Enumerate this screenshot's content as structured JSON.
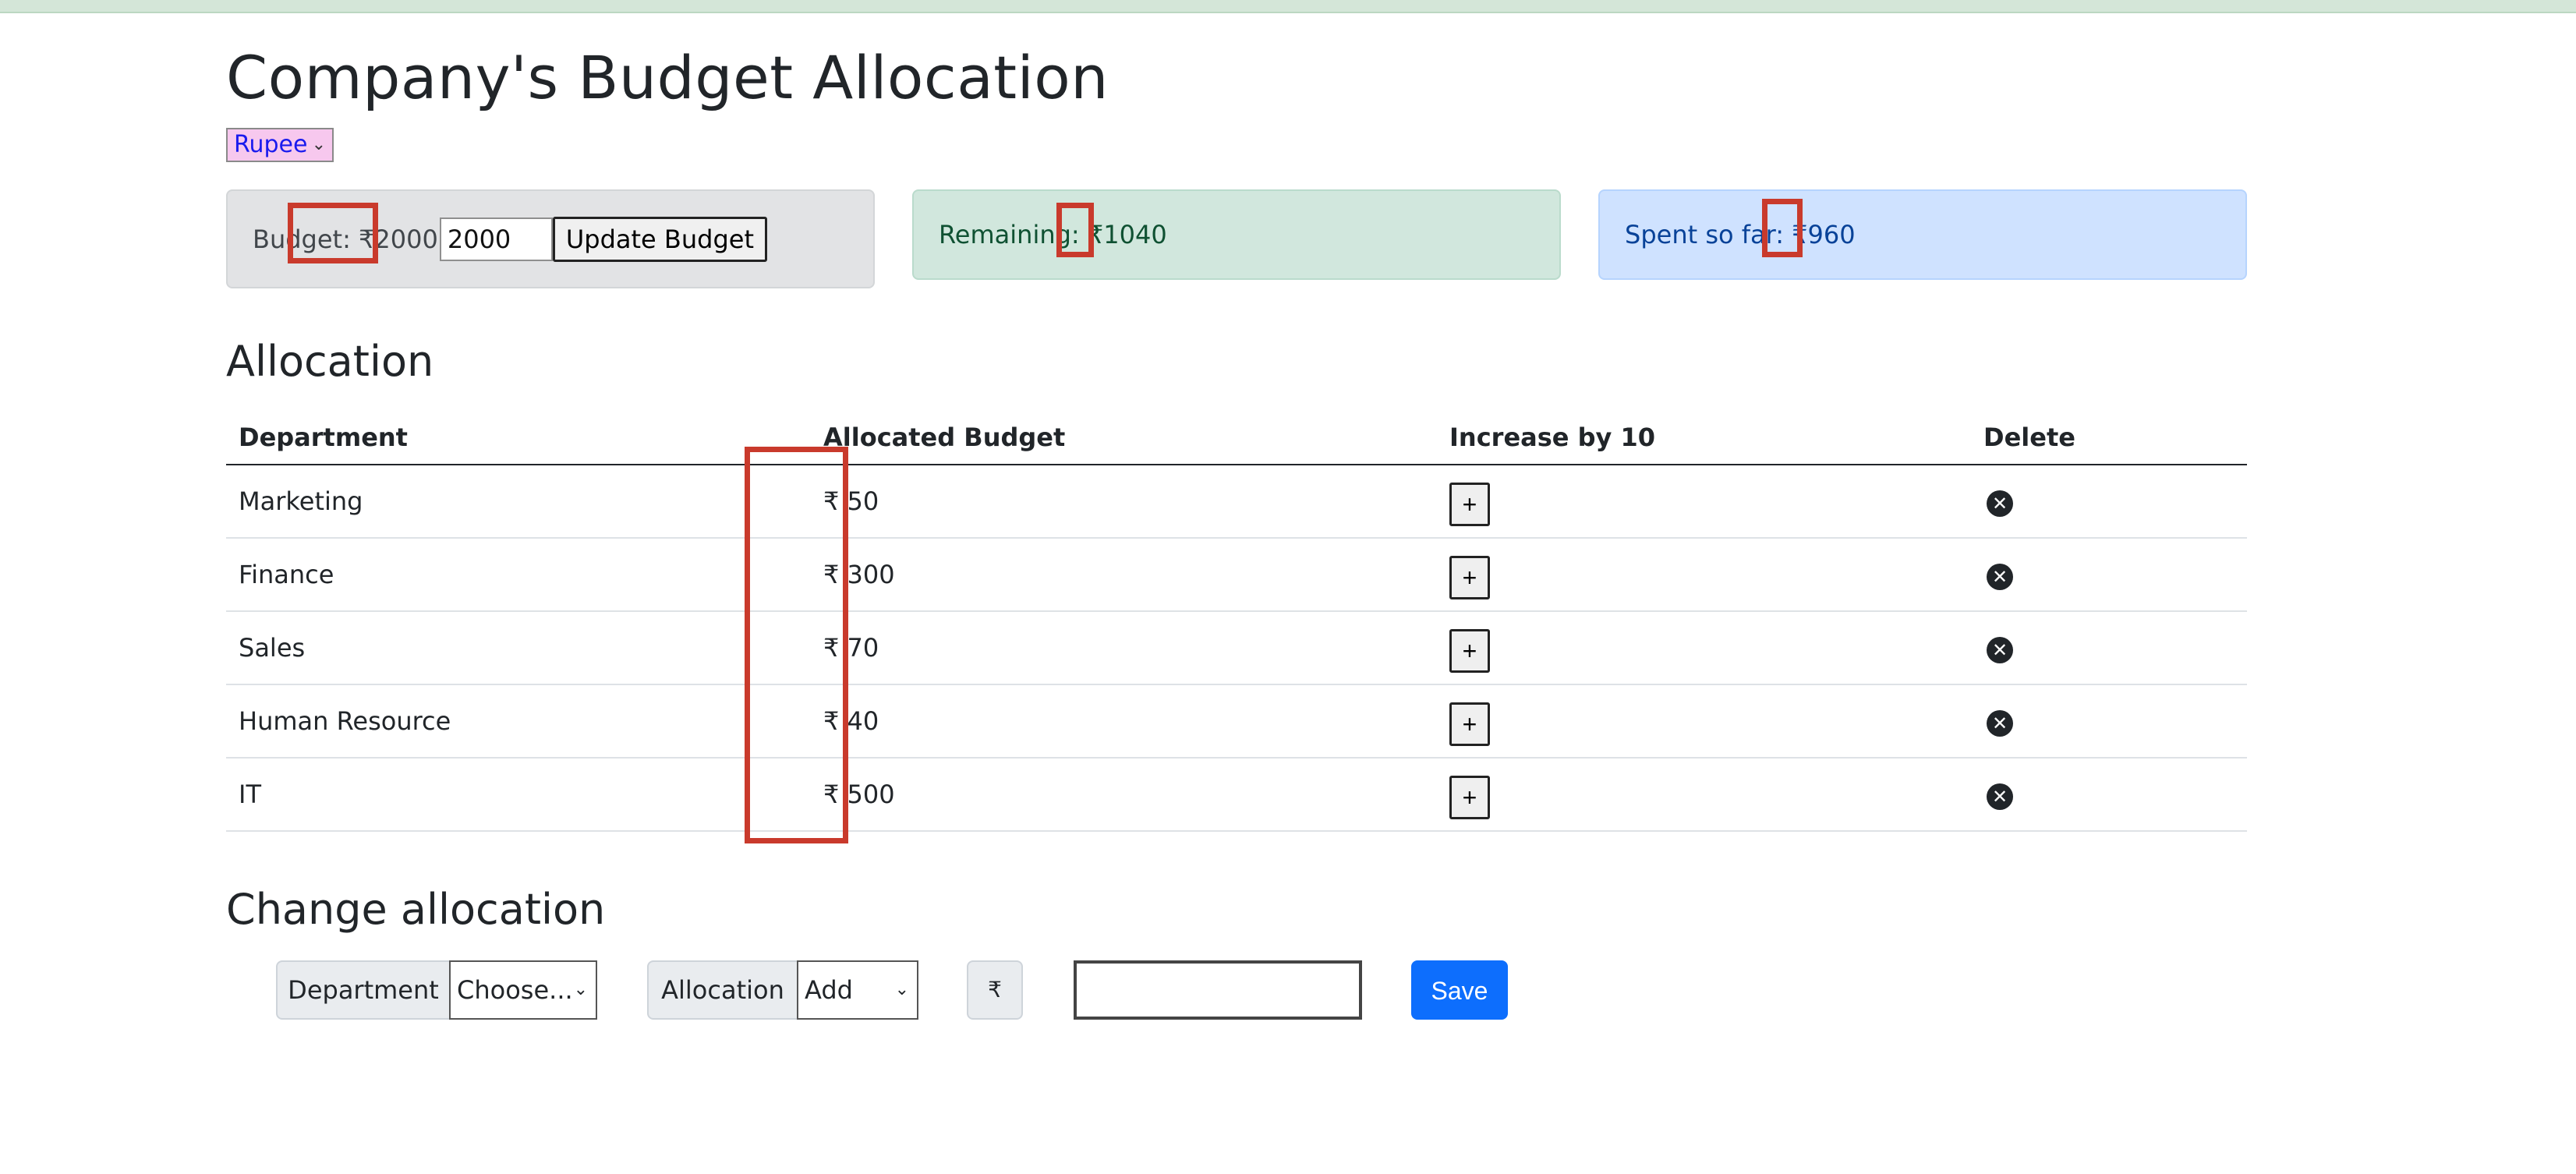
{
  "title": "Company's Budget Allocation",
  "currency": {
    "selected": "Rupee",
    "symbol": "₹"
  },
  "budget_card": {
    "label": "Budget: ₹2000",
    "input_value": "2000",
    "button_label": "Update Budget"
  },
  "remaining_card": {
    "label": "Remaining: ₹1040"
  },
  "spent_card": {
    "label": "Spent so far: ₹960"
  },
  "allocation": {
    "title": "Allocation",
    "headers": [
      "Department",
      "Allocated Budget",
      "Increase by 10",
      "Delete"
    ],
    "rows": [
      {
        "department": "Marketing",
        "budget": "₹ 50",
        "increase_label": "+",
        "delete_icon": "circle-x-icon"
      },
      {
        "department": "Finance",
        "budget": "₹ 300",
        "increase_label": "+",
        "delete_icon": "circle-x-icon"
      },
      {
        "department": "Sales",
        "budget": "₹ 70",
        "increase_label": "+",
        "delete_icon": "circle-x-icon"
      },
      {
        "department": "Human Resource",
        "budget": "₹ 40",
        "increase_label": "+",
        "delete_icon": "circle-x-icon"
      },
      {
        "department": "IT",
        "budget": "₹ 500",
        "increase_label": "+",
        "delete_icon": "circle-x-icon"
      }
    ]
  },
  "change_allocation": {
    "title": "Change allocation",
    "department_label": "Department",
    "department_value": "Choose...",
    "allocation_label": "Allocation",
    "allocation_value": "Add",
    "currency_symbol": "₹",
    "amount_value": "",
    "save_label": "Save"
  },
  "colors": {
    "highlight": "#c93a2c",
    "save_button": "#0d6efd"
  }
}
